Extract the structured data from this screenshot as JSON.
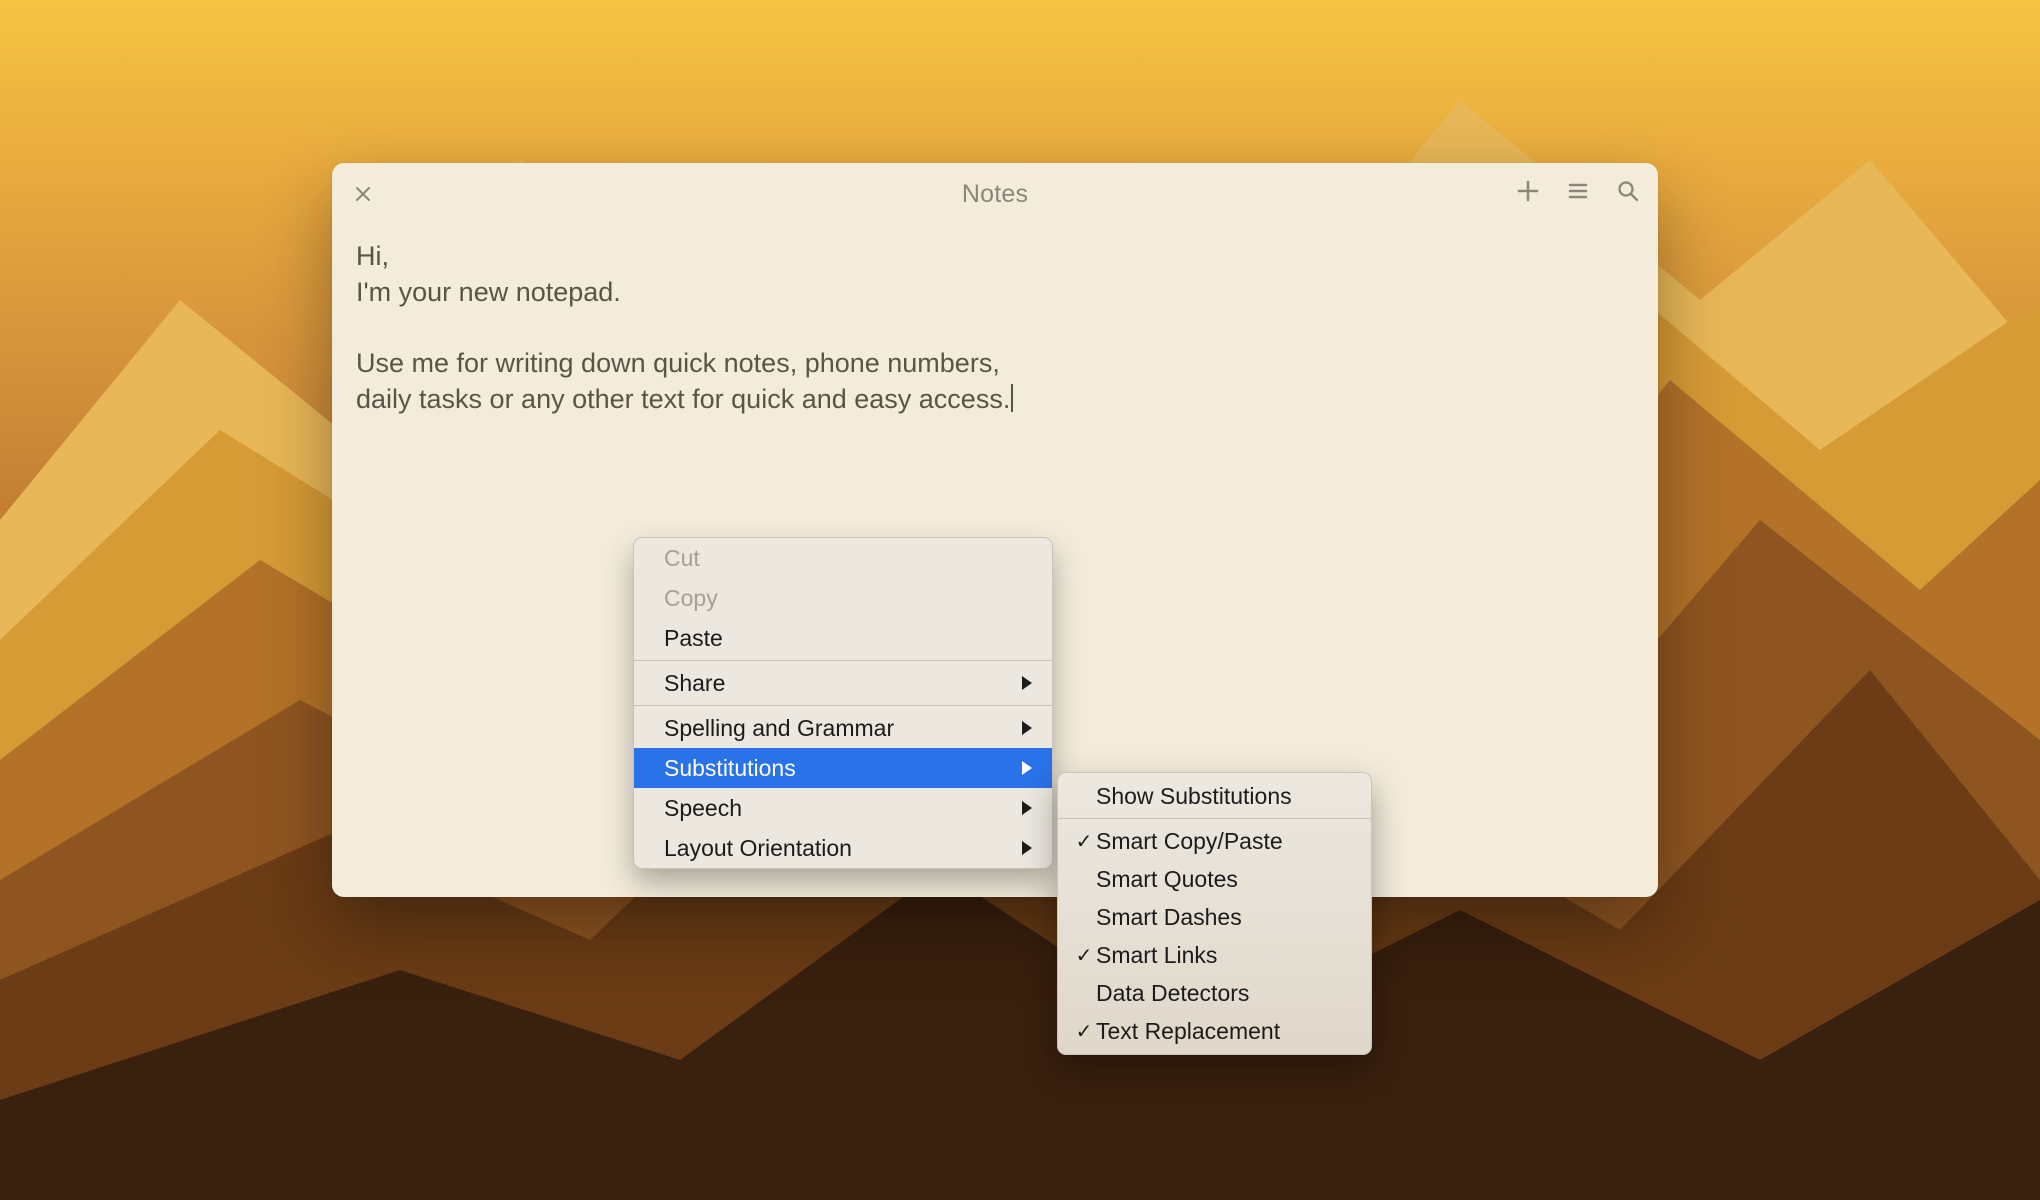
{
  "window": {
    "title": "Notes"
  },
  "note": {
    "line1": "Hi,",
    "line2": "I'm your new notepad.",
    "line3": "Use me for writing down quick notes, phone numbers,",
    "line4": "daily tasks or any other text for quick and easy access."
  },
  "context_menu": {
    "cut": "Cut",
    "copy": "Copy",
    "paste": "Paste",
    "share": "Share",
    "spelling": "Spelling and Grammar",
    "substitutions": "Substitutions",
    "speech": "Speech",
    "layout": "Layout Orientation"
  },
  "submenu": {
    "show_subs": "Show Substitutions",
    "smart_copy": "Smart Copy/Paste",
    "smart_quotes": "Smart Quotes",
    "smart_dashes": "Smart Dashes",
    "smart_links": "Smart Links",
    "data_detectors": "Data Detectors",
    "text_replacement": "Text Replacement"
  }
}
